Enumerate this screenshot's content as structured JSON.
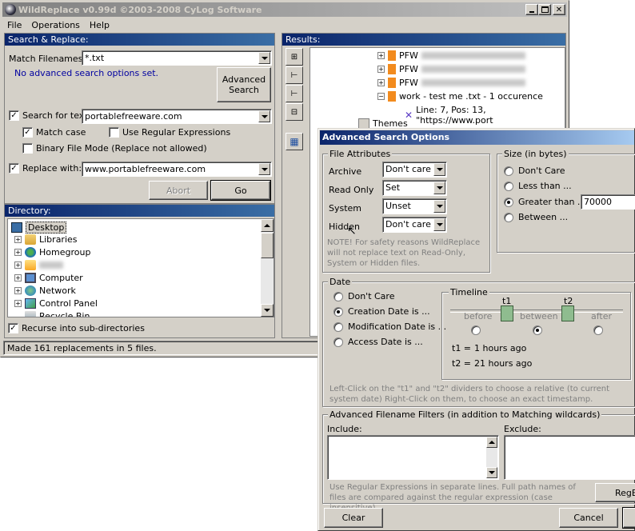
{
  "main": {
    "title": "WildReplace v0.99d ©2003-2008 CyLog Software",
    "menu": [
      "File",
      "Operations",
      "Help"
    ],
    "search_replace": {
      "header": "Search & Replace:",
      "match_filenames_label": "Match Filenames:",
      "match_filenames_value": "*.txt",
      "no_advanced_text": "No advanced search options set.",
      "advanced_search_button": "Advanced\nSearch",
      "search_for_label": "Search for text:",
      "search_for_value": "portablefreeware.com",
      "match_case_label": "Match case",
      "regex_label": "Use Regular Expressions",
      "binary_label": "Binary File Mode (Replace not allowed)",
      "replace_with_label": "Replace with:",
      "replace_with_value": "www.portablefreeware.com",
      "abort_button": "Abort",
      "go_button": "Go"
    },
    "directory": {
      "header": "Directory:",
      "items": [
        "Desktop",
        "Libraries",
        "Homegroup",
        "",
        "Computer",
        "Network",
        "Control Panel",
        "Recycle Bin"
      ],
      "recurse_label": "Recurse into sub-directories"
    },
    "results": {
      "header": "Results:",
      "items": [
        "PFW",
        "PFW",
        "PFW",
        "work - test me .txt - 1 occurence",
        "Line: 7, Pos: 13, \"https://www.port",
        "Themes"
      ]
    },
    "status": "Made 161 replacements in 5 files."
  },
  "dialog": {
    "title": "Advanced Search Options",
    "file_attributes": {
      "title": "File Attributes",
      "rows": [
        {
          "label": "Archive",
          "value": "Don't care"
        },
        {
          "label": "Read Only",
          "value": "Set"
        },
        {
          "label": "System",
          "value": "Unset"
        },
        {
          "label": "Hidden",
          "value": "Don't care"
        }
      ],
      "note": "NOTE! For safety reasons WildReplace will not replace text on Read-Only, System or Hidden files."
    },
    "size": {
      "title": "Size (in bytes)",
      "options": [
        "Don't Care",
        "Less than ...",
        "Greater than ...",
        "Between ..."
      ],
      "selected": 2,
      "value": "70000"
    },
    "date": {
      "title": "Date",
      "options": [
        "Don't Care",
        "Creation Date is ...",
        "Modification Date is ...",
        "Access Date is ..."
      ],
      "selected": 1,
      "timeline": {
        "title": "Timeline",
        "t1": "t1",
        "t2": "t2",
        "before": "before",
        "between": "between",
        "after": "after",
        "selected": 1,
        "t1_label": "t1 =",
        "t1_value": "1 hours ago",
        "t2_label": "t2 =",
        "t2_value": "21 hours ago"
      },
      "hint": "Left-Click on the \"t1\" and \"t2\" dividers to choose a relative (to current system date) Right-Click on them, to choose an exact timestamp."
    },
    "filters": {
      "title": "Advanced Filename Filters (in addition to Matching wildcards)",
      "include_label": "Include:",
      "exclude_label": "Exclude:",
      "hint": "Use Regular Expressions in separate lines. Full path names of files are compared against the regular expression (case insensitive).",
      "regex_button": "RegE"
    },
    "clear_button": "Clear",
    "cancel_button": "Cancel"
  }
}
